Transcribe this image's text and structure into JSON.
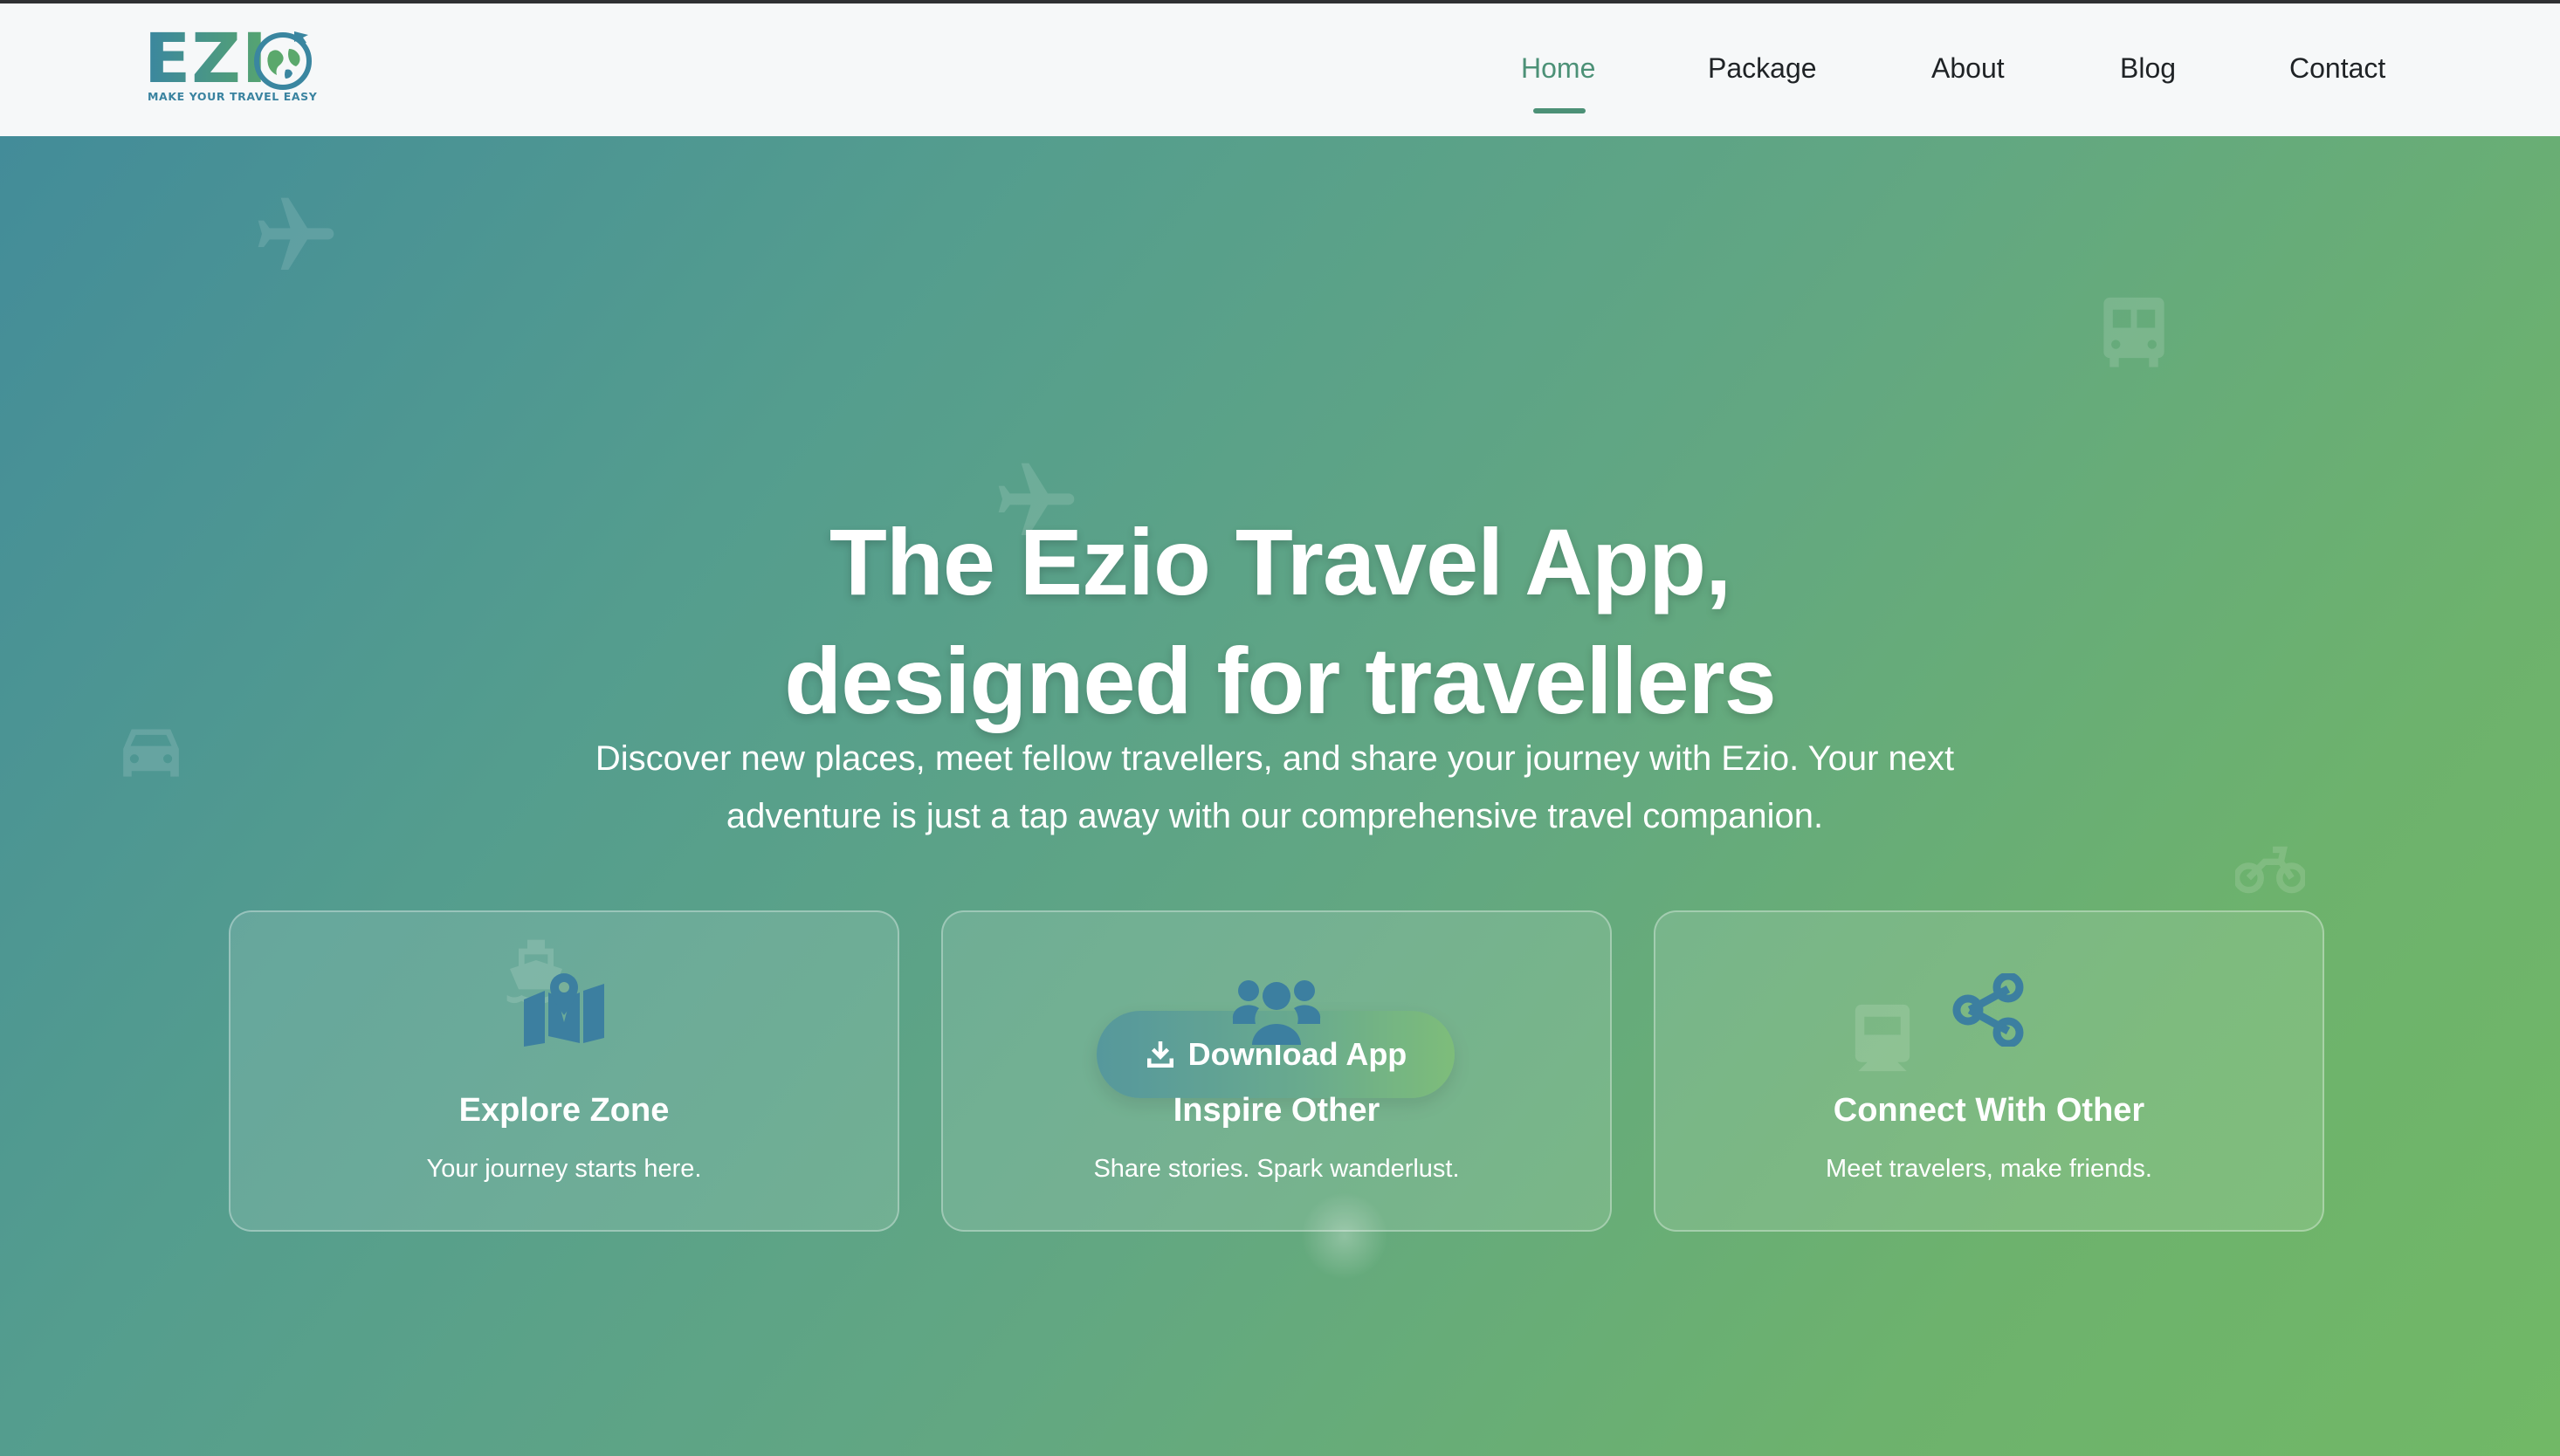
{
  "logo": {
    "letters": "EZI",
    "tagline": "MAKE YOUR TRAVEL EASY",
    "brand_colors": [
      "#3d8d9b",
      "#5aa86c"
    ]
  },
  "nav": {
    "items": [
      {
        "label": "Home",
        "active": true
      },
      {
        "label": "Package",
        "active": false
      },
      {
        "label": "About",
        "active": false
      },
      {
        "label": "Blog",
        "active": false
      },
      {
        "label": "Contact",
        "active": false
      }
    ],
    "active_color": "#4c9177"
  },
  "hero": {
    "title_line1": "The Ezio Travel App,",
    "title_line2": "designed for travellers",
    "description": "Discover new places, meet fellow travellers, and share your journey with Ezio. Your next adventure is just a tap away with our comprehensive travel companion.",
    "cta_label": "Download App",
    "cta_icon": "download-icon",
    "background_decorations": [
      "plane-icon",
      "plane-icon",
      "bus-icon",
      "car-icon",
      "motorcycle-icon",
      "ship-icon",
      "train-icon"
    ]
  },
  "features": [
    {
      "icon": "map-pin-icon",
      "title": "Explore Zone",
      "subtitle": "Your journey starts here."
    },
    {
      "icon": "users-icon",
      "title": "Inspire Other",
      "subtitle": "Share stories. Spark wanderlust."
    },
    {
      "icon": "share-icon",
      "title": "Connect With Other",
      "subtitle": "Meet travelers, make friends."
    }
  ],
  "colors": {
    "gradient_start": "#438c99",
    "gradient_end": "#71b866",
    "feature_icon": "#3c7fa0"
  }
}
